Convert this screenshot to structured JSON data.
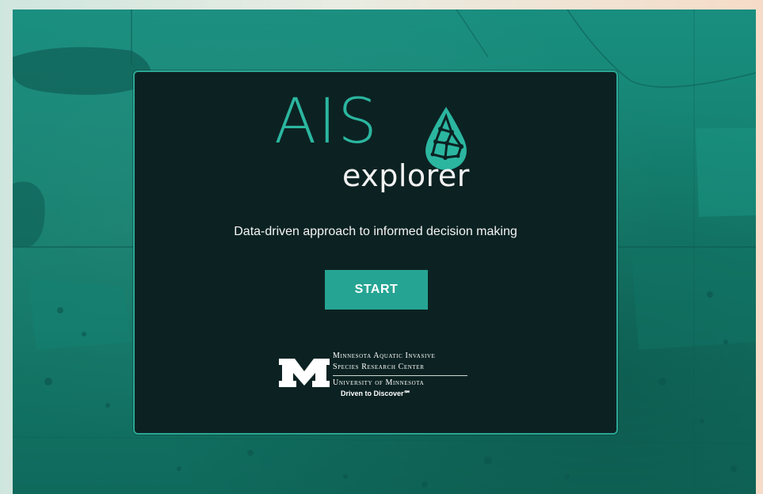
{
  "colors": {
    "map_teal": "#178a7b",
    "card_bg": "#0c2222",
    "card_border": "#2aa896",
    "accent": "#2bb6a0",
    "button_bg": "#26a493",
    "text_light": "#f4f4f4"
  },
  "logo": {
    "title": "AIS",
    "subtitle": "explorer",
    "icon": "water-drop-network-icon"
  },
  "tagline": "Data-driven approach to informed decision making",
  "start_button": {
    "label": "START"
  },
  "partner": {
    "icon": "university-of-minnesota-m-logo",
    "line1": "Minnesota Aquatic Invasive",
    "line2": "Species Research Center",
    "line3": "University of Minnesota",
    "line4": "Driven to Discover℠"
  }
}
